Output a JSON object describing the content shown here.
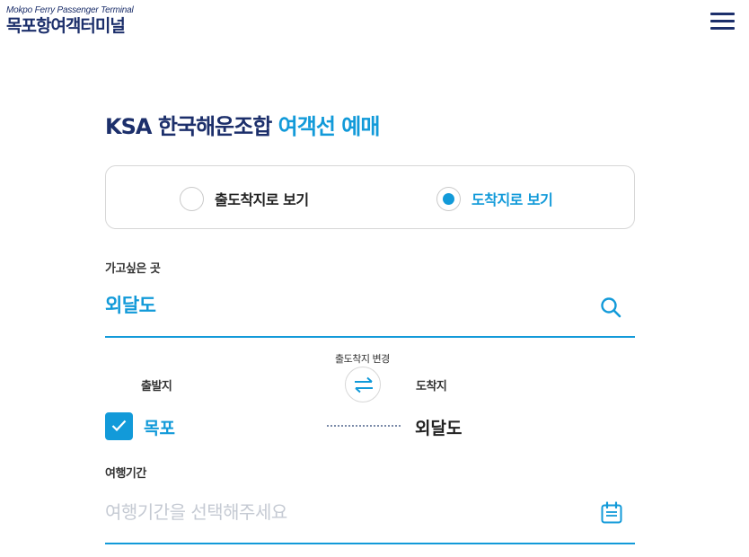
{
  "header": {
    "logo_subtitle": "Mokpo Ferry Passenger Terminal",
    "logo_title": "목포항여객터미널",
    "menu_icon": "hamburger-menu-icon"
  },
  "page": {
    "title_part1": "KSA 한국해운조합",
    "title_part2": "여객선 예매"
  },
  "view_toggle": {
    "options": [
      {
        "label": "출도착지로 보기",
        "selected": false
      },
      {
        "label": "도착지로 보기",
        "selected": true
      }
    ]
  },
  "destination": {
    "label": "가고싶은 곳",
    "value": "외달도",
    "icon": "search-icon"
  },
  "route": {
    "swap_caption": "출도착지 변경",
    "swap_icon": "swap-arrows-icon",
    "departure_label": "출발지",
    "departure_value": "목포",
    "departure_checked": true,
    "arrival_label": "도착지",
    "arrival_value": "외달도"
  },
  "period": {
    "label": "여행기간",
    "value": "",
    "placeholder": "여행기간을 선택해주세요",
    "icon": "calendar-icon"
  },
  "colors": {
    "navy": "#1c2f6b",
    "accent": "#129ad9",
    "border": "#d7d7d7",
    "placeholder": "#c5cad3"
  }
}
